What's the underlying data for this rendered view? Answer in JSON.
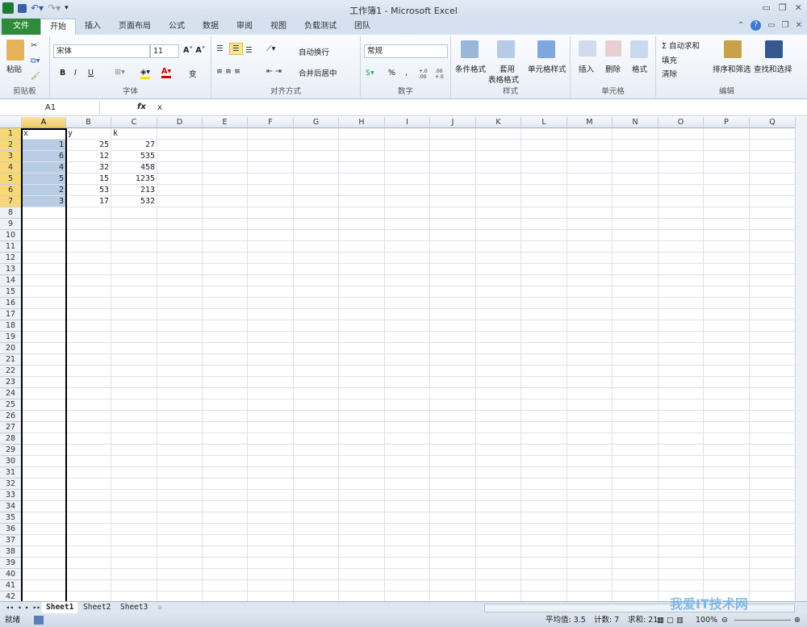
{
  "title": "工作簿1 - Microsoft Excel",
  "qat": [
    "excel-logo",
    "save",
    "undo",
    "redo",
    "customize"
  ],
  "tabs": [
    "文件",
    "开始",
    "插入",
    "页面布局",
    "公式",
    "数据",
    "审阅",
    "视图",
    "负载测试",
    "团队"
  ],
  "ribbon": {
    "clipboard": {
      "paste": "粘贴",
      "label": "剪贴板"
    },
    "font": {
      "name": "宋体",
      "size": "11",
      "bold": "B",
      "italic": "I",
      "underline": "U",
      "label": "字体",
      "phonetic": "变"
    },
    "alignment": {
      "wrap": "自动换行",
      "merge": "合并后居中",
      "label": "对齐方式"
    },
    "number": {
      "format": "常规",
      "percent": "%",
      "comma": ",",
      "inc": "+.0 .00",
      "dec": ".00 +.0",
      "label": "数字"
    },
    "styles": {
      "cond": "条件格式",
      "table1": "套用",
      "table2": "表格格式",
      "cell": "单元格样式",
      "label": "样式"
    },
    "cells": {
      "insert": "插入",
      "delete": "删除",
      "format": "格式",
      "label": "单元格"
    },
    "editing": {
      "autosum": "Σ 自动求和",
      "fill": "填充",
      "clear": "清除",
      "sort": "排序和筛选",
      "find": "查找和选择",
      "label": "编辑"
    }
  },
  "formula": {
    "namebox": "A1",
    "fx": "fx",
    "value": "x"
  },
  "columns": [
    "A",
    "B",
    "C",
    "D",
    "E",
    "F",
    "G",
    "H",
    "I",
    "J",
    "K",
    "L",
    "M",
    "N",
    "O",
    "P",
    "Q"
  ],
  "row_count": 42,
  "cells": [
    [
      "x",
      "y",
      "k"
    ],
    [
      1,
      25,
      27
    ],
    [
      6,
      12,
      535
    ],
    [
      4,
      32,
      458
    ],
    [
      5,
      15,
      1235
    ],
    [
      2,
      53,
      213
    ],
    [
      3,
      17,
      532
    ]
  ],
  "sheets": [
    "Sheet1",
    "Sheet2",
    "Sheet3"
  ],
  "status": {
    "ready": "就绪",
    "average": "平均值: 3.5",
    "count": "计数: 7",
    "sum": "求和: 21",
    "zoom": "100%"
  },
  "watermark": "我爱IT技术网"
}
